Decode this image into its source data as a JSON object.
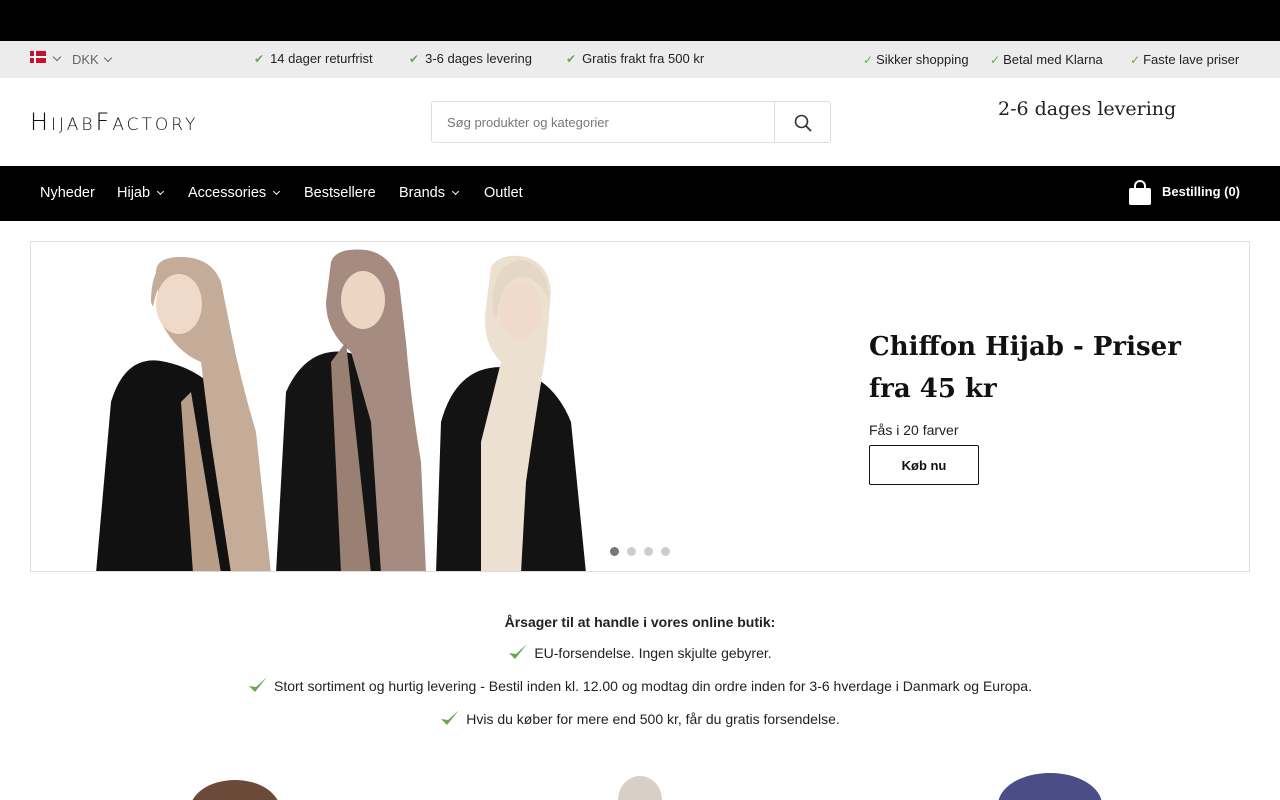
{
  "topbar": {},
  "infobar": {
    "currency": "DKK",
    "usps_left": [
      "14 dager returfrist",
      "3-6 dages levering",
      "Gratis frakt fra 500 kr"
    ],
    "usps_right": [
      "Sikker shopping",
      "Betal med Klarna",
      "Faste lave priser"
    ]
  },
  "header": {
    "logo_text": "HijabFactory",
    "search_placeholder": "Søg produkter og kategorier",
    "delivery_note": "2-6 dages levering"
  },
  "nav": {
    "items": [
      {
        "label": "Nyheder",
        "dropdown": false
      },
      {
        "label": "Hijab",
        "dropdown": true
      },
      {
        "label": "Accessories",
        "dropdown": true
      },
      {
        "label": "Bestsellere",
        "dropdown": false
      },
      {
        "label": "Brands",
        "dropdown": true
      },
      {
        "label": "Outlet",
        "dropdown": false
      }
    ],
    "cart_label": "Bestilling (0)"
  },
  "hero": {
    "title": "Chiffon Hijab - Priser fra 45 kr",
    "subtitle": "Fås i 20 farver",
    "button_label": "Køb nu",
    "slides_total": 4,
    "active_slide": 1
  },
  "reasons": {
    "heading": "Årsager til at handle i vores online butik:",
    "items": [
      "EU-forsendelse. Ingen skjulte gebyrer.",
      "Stort sortiment og hurtig levering - Bestil inden kl. 12.00 og modtag din ordre inden for 3-6 hverdage i Danmark og Europa.",
      "Hvis du køber for mere end 500 kr, får du gratis forsendelse."
    ]
  },
  "colors": {
    "black": "#000000",
    "check_green": "#6aa84f",
    "infobar_bg": "#ececec"
  }
}
